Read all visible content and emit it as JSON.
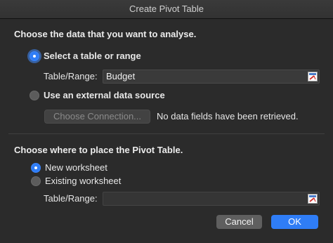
{
  "window": {
    "title": "Create Pivot Table"
  },
  "source_section": {
    "heading": "Choose the data that you want to analyse.",
    "option_range": {
      "label": "Select a table or range",
      "selected": true
    },
    "range_field": {
      "label": "Table/Range:",
      "value": "Budget"
    },
    "option_external": {
      "label": "Use an external data source",
      "selected": false
    },
    "choose_connection_label": "Choose Connection...",
    "connection_status": "No data fields have been retrieved."
  },
  "placement_section": {
    "heading": "Choose where to place the Pivot Table.",
    "option_new": {
      "label": "New worksheet",
      "selected": true
    },
    "option_existing": {
      "label": "Existing worksheet",
      "selected": false
    },
    "range_field": {
      "label": "Table/Range:",
      "value": ""
    }
  },
  "footer": {
    "cancel_label": "Cancel",
    "ok_label": "OK"
  },
  "colors": {
    "accent": "#2f7df6",
    "background": "#2b2b2b",
    "text": "#e6e6e6"
  },
  "icons": {
    "range_picker": "range-select-icon"
  }
}
